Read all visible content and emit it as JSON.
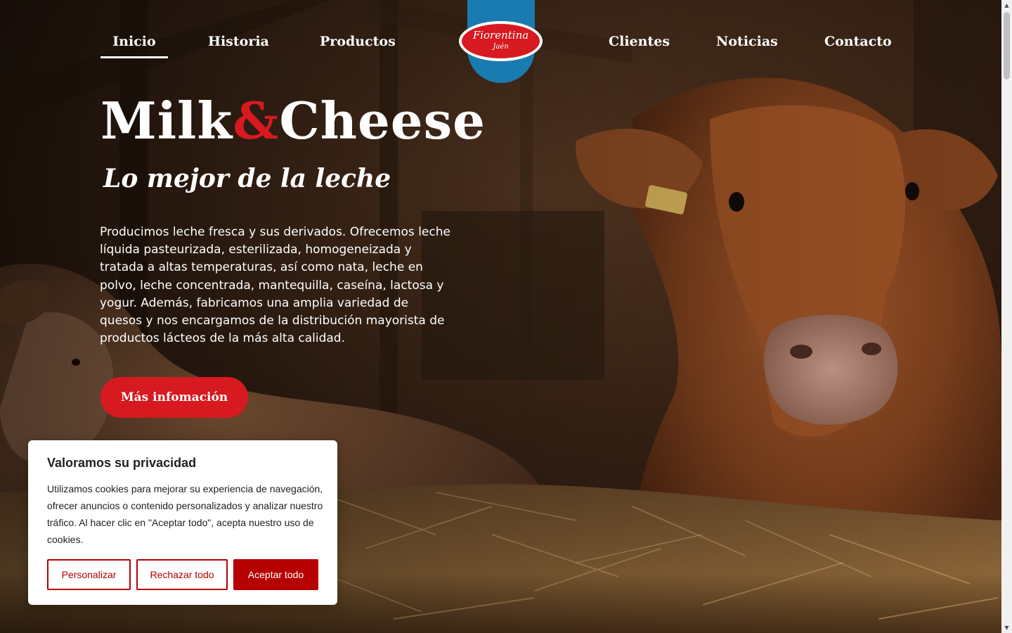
{
  "nav": {
    "items": [
      {
        "label": "Inicio",
        "active": true
      },
      {
        "label": "Historia"
      },
      {
        "label": "Productos"
      },
      {
        "label": "Clientes"
      },
      {
        "label": "Noticias"
      },
      {
        "label": "Contacto"
      }
    ],
    "logo": {
      "name": "Fiorentina",
      "sub": "Jaén"
    }
  },
  "hero": {
    "title_part1": "Milk",
    "title_amp": "&",
    "title_part2": "Cheese",
    "subtitle": "Lo mejor de la leche",
    "body": "Producimos leche fresca y sus derivados. Ofrecemos leche líquida pasteurizada, esterilizada, homogeneizada y tratada a altas temperaturas, así como nata, leche en polvo, leche concentrada, mantequilla, caseína, lactosa y yogur. Además, fabricamos una amplia variedad de quesos y nos encargamos de la distribución mayorista de productos lácteos de la más alta calidad.",
    "cta_label": "Más infomación"
  },
  "cookie": {
    "title": "Valoramos su privacidad",
    "text": "Utilizamos cookies para mejorar su experiencia de navegación, ofrecer anuncios o contenido personalizados y analizar nuestro tráfico. Al hacer clic en \"Aceptar todo\", acepta nuestro uso de cookies.",
    "customize_label": "Personalizar",
    "reject_label": "Rechazar todo",
    "accept_label": "Aceptar todo"
  },
  "colors": {
    "brand_red": "#d71920",
    "cookie_red": "#b60000",
    "logo_blue": "#1a7bb0"
  },
  "icons": {
    "scroll_up": "triangle-up-icon",
    "scroll_down": "triangle-down-icon"
  }
}
